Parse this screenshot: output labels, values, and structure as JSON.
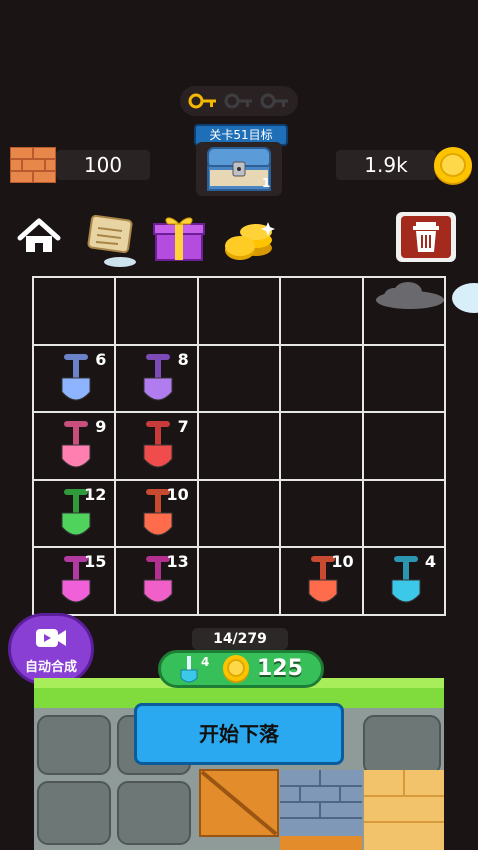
{
  "keys": {
    "icons": [
      "gold-key-icon",
      "gray-key-icon",
      "gray-key-icon"
    ],
    "collected": 1
  },
  "level_target": {
    "label": "关卡51目标",
    "chest_count": "1"
  },
  "bricks": {
    "icon": "brick-icon",
    "value": "100"
  },
  "coins": {
    "icon": "coin-icon",
    "value": "1.9k"
  },
  "toolbar": {
    "home": "home-icon",
    "scroll": "scroll-icon",
    "gift": "gift-icon",
    "coins": "coin-stack-icon",
    "trash": "trash-icon"
  },
  "grid": {
    "rows": [
      [
        null,
        null,
        null,
        null,
        null
      ],
      [
        {
          "n": "6",
          "color": "#8fb4ff",
          "handle": "#6a82c8"
        },
        {
          "n": "8",
          "color": "#b07cf0",
          "handle": "#7c4bb8"
        },
        null,
        null,
        null
      ],
      [
        {
          "n": "9",
          "color": "#ff7fb0",
          "handle": "#c84f7c"
        },
        {
          "n": "7",
          "color": "#f04c4c",
          "handle": "#c83b3b"
        },
        null,
        null,
        null
      ],
      [
        {
          "n": "12",
          "color": "#4fd35c",
          "handle": "#2e9a3a"
        },
        {
          "n": "10",
          "color": "#ff6c4c",
          "handle": "#c84a30"
        },
        null,
        null,
        null
      ],
      [
        {
          "n": "15",
          "color": "#f060d8",
          "handle": "#b23aa0"
        },
        {
          "n": "13",
          "color": "#f060c8",
          "handle": "#b2308f"
        },
        null,
        {
          "n": "10",
          "color": "#ff6c4c",
          "handle": "#c84a30"
        },
        {
          "n": "4",
          "color": "#3cc8e8",
          "handle": "#2a96b0"
        }
      ]
    ]
  },
  "auto_merge": {
    "label": "自动合成",
    "icon": "video-icon"
  },
  "progress": "14/279",
  "cost": {
    "shovel_count": "4",
    "coin_cost": "125"
  },
  "start_button": "开始下落"
}
